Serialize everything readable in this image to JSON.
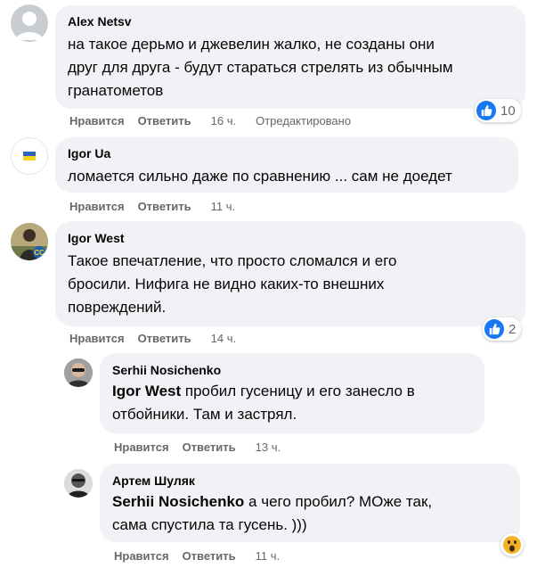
{
  "actions": {
    "like": "Нравится",
    "reply": "Ответить"
  },
  "comments": [
    {
      "author": "Alex Netsv",
      "lines": [
        "на такое дерьмо и джевелин жалко, не созданы они",
        "друг для друга - будут стараться стрелять из обычным",
        "гранатометов"
      ],
      "time": "16 ч.",
      "edited": "Отредактировано",
      "reaction_count": "10"
    },
    {
      "author": "Igor Ua",
      "lines": [
        "ломается сильно даже по сравнению ... сам не доедет"
      ],
      "time": "11 ч."
    },
    {
      "author": "Igor West",
      "lines": [
        "Такое впечатление, что просто сломался и его",
        "бросили. Нифига не видно каких-то внешних",
        "повреждений."
      ],
      "time": "14 ч.",
      "reaction_count": "2"
    }
  ],
  "replies": [
    {
      "author": "Serhii Nosichenko",
      "mention": "Igor West",
      "line1_rest": " пробил гусеницу и его занесло в",
      "line2": "отбойники. Там и застрял.",
      "time": "13 ч."
    },
    {
      "author": "Артем Шуляк",
      "mention": "Serhii Nosichenko",
      "line1_rest": " а чего пробил? МОже так,",
      "line2": "сама спустила та гусень. )))",
      "time": "11 ч."
    }
  ],
  "colors": {
    "like_blue": "#1877f2",
    "bubble": "#f0f2f5",
    "meta": "#65676b"
  }
}
